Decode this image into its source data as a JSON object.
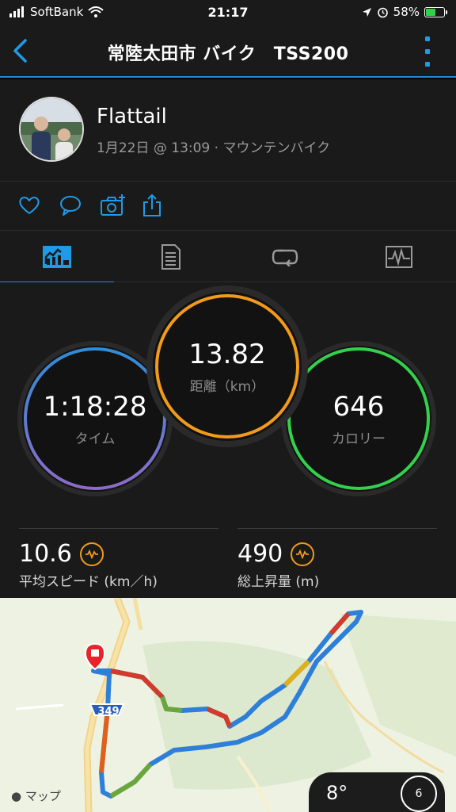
{
  "status_bar": {
    "carrier": "SoftBank",
    "time": "21:17",
    "battery": "58%",
    "battery_level": 0.58
  },
  "header": {
    "title": "常陸太田市 バイク　TSS200"
  },
  "activity": {
    "user_name": "Flattail",
    "meta": "1月22日 @ 13:09 · マウンテンバイク"
  },
  "stats": {
    "distance": {
      "value": "13.82",
      "label": "距離（km）"
    },
    "time": {
      "value": "1:18:28",
      "label": "タイム"
    },
    "calories": {
      "value": "646",
      "label": "カロリー"
    },
    "avg_speed": {
      "value": "10.6",
      "label": "平均スピード (km／h)"
    },
    "elevation_gain": {
      "value": "490",
      "label": "総上昇量 (m)"
    }
  },
  "map": {
    "route_marker": "349",
    "attribution": "マップ"
  },
  "weather": {
    "temperature": "8°",
    "wind_speed": "6"
  },
  "colors": {
    "accent": "#1f8bd1",
    "distance_ring": "#f29a1a",
    "time_ring_start": "#2f8cd6",
    "time_ring_end": "#8d6bc6",
    "calories_ring": "#33d14b",
    "background": "#1a1a1a"
  },
  "icons": {
    "back": "chevron-left-icon",
    "more": "more-vertical-icon",
    "like": "heart-icon",
    "comment": "comment-icon",
    "photo": "camera-icon",
    "share": "share-icon",
    "tab_overview": "overview-icon",
    "tab_details": "document-icon",
    "tab_laps": "laps-icon",
    "tab_charts": "chart-icon"
  }
}
